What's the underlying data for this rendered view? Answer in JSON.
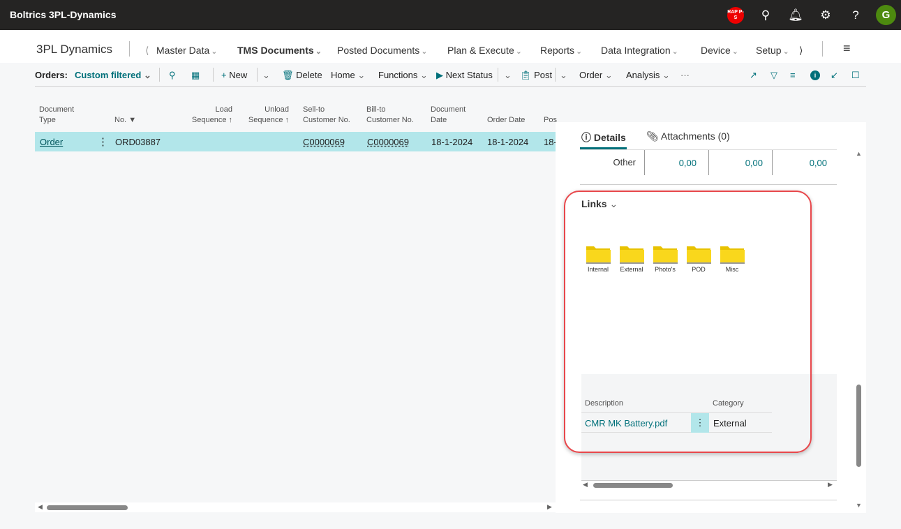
{
  "topbar": {
    "title": "Boltrics 3PL-Dynamics",
    "badge": "RAP P-S",
    "avatar": "G",
    "icons": [
      "search-icon",
      "bell-icon",
      "gear-icon",
      "help-icon"
    ]
  },
  "nav": {
    "company": "3PL Dynamics",
    "items": [
      "Master Data",
      "TMS Documents",
      "Posted Documents",
      "Plan & Execute",
      "Reports",
      "Data Integration",
      "Device",
      "Setup"
    ]
  },
  "actions": {
    "orders_label": "Orders:",
    "filter": "Custom filtered",
    "new": "New",
    "delete": "Delete",
    "home": "Home",
    "functions": "Functions",
    "next_status": "Next Status",
    "post": "Post",
    "order": "Order",
    "analysis": "Analysis",
    "more": "···"
  },
  "table": {
    "headers": [
      [
        "Document",
        "Type"
      ],
      [
        "",
        "No."
      ],
      [
        "Load",
        "Sequence"
      ],
      [
        "Unload",
        "Sequence"
      ],
      [
        "Sell-to",
        "Customer No."
      ],
      [
        "Bill-to",
        "Customer No."
      ],
      [
        "Document",
        "Date"
      ],
      [
        "",
        "Order Date"
      ],
      [
        "",
        "Pos"
      ]
    ],
    "row": {
      "type": "Order",
      "no": "ORD03887",
      "sell_to": "C0000069",
      "bill_to": "C0000069",
      "doc_date": "18-1-2024",
      "order_date": "18-1-2024",
      "post": "18-"
    }
  },
  "factbox": {
    "tabs": {
      "details": "Details",
      "attachments": "Attachments (0)"
    },
    "other_label": "Other",
    "other_values": [
      "0,00",
      "0,00",
      "0,00"
    ],
    "links_title": "Links",
    "folders": [
      "Internal",
      "External",
      "Photo's",
      "POD",
      "Misc"
    ],
    "links_table": {
      "headers": [
        "Description",
        "Category"
      ],
      "rows": [
        {
          "description": "CMR MK Battery.pdf",
          "category": "External"
        }
      ]
    }
  },
  "colors": {
    "accent": "#00707a",
    "selected_row": "#b2e6ea",
    "highlight": "#e8474b",
    "topbar": "#252423"
  }
}
